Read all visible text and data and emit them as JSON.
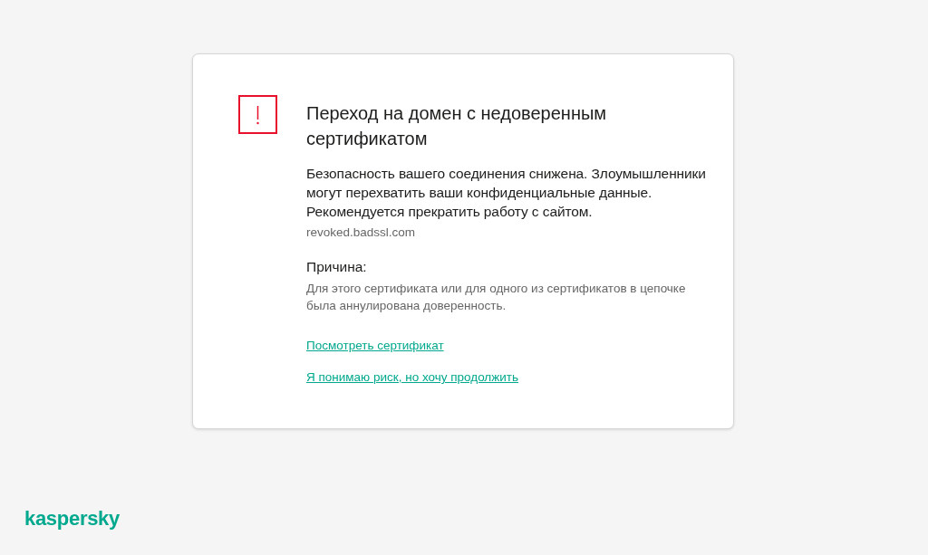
{
  "warning": {
    "title": "Переход на домен с недоверенным сертификатом",
    "message": "Безопасность вашего соединения снижена. Злоумышленники могут перехватить ваши конфиденциальные данные. Рекомендуется прекратить работу с сайтом.",
    "domain": "revoked.badssl.com",
    "reason_heading": "Причина:",
    "reason": "Для этого сертификата или для одного из сертификатов в цепочке была аннулирована доверенность.",
    "links": [
      {
        "label": "Посмотреть сертификат"
      },
      {
        "label": "Я понимаю риск, но хочу продолжить"
      }
    ]
  },
  "brand": {
    "logo": "kaspersky"
  }
}
